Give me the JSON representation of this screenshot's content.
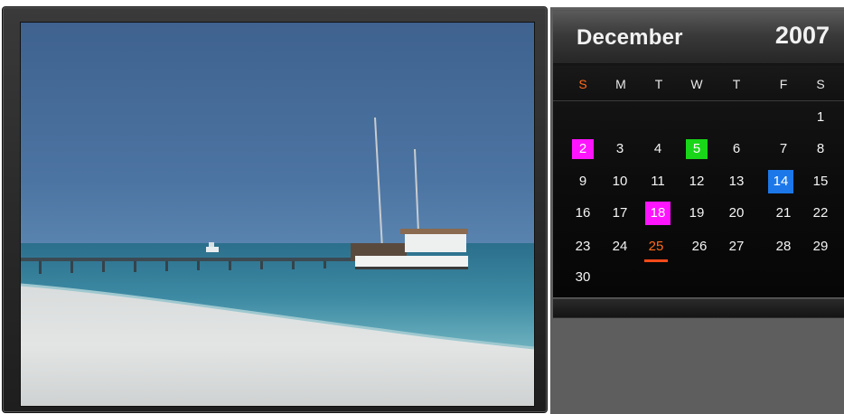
{
  "photo": {
    "description_icon": "beach-photo"
  },
  "calendar": {
    "month": "December",
    "year": "2007",
    "weekdays": [
      "S",
      "M",
      "T",
      "W",
      "T",
      "F",
      "S"
    ],
    "days": [
      "1",
      "2",
      "3",
      "4",
      "5",
      "6",
      "7",
      "8",
      "9",
      "10",
      "11",
      "12",
      "13",
      "14",
      "15",
      "16",
      "17",
      "18",
      "19",
      "20",
      "21",
      "22",
      "23",
      "24",
      "25",
      "26",
      "27",
      "28",
      "29",
      "30"
    ],
    "highlight_colors": {
      "sunday": "#ff6a1a",
      "magenta": "#ff14ff",
      "green": "#19d619",
      "blue": "#1c78e8",
      "today": "#ff4a1a"
    }
  }
}
